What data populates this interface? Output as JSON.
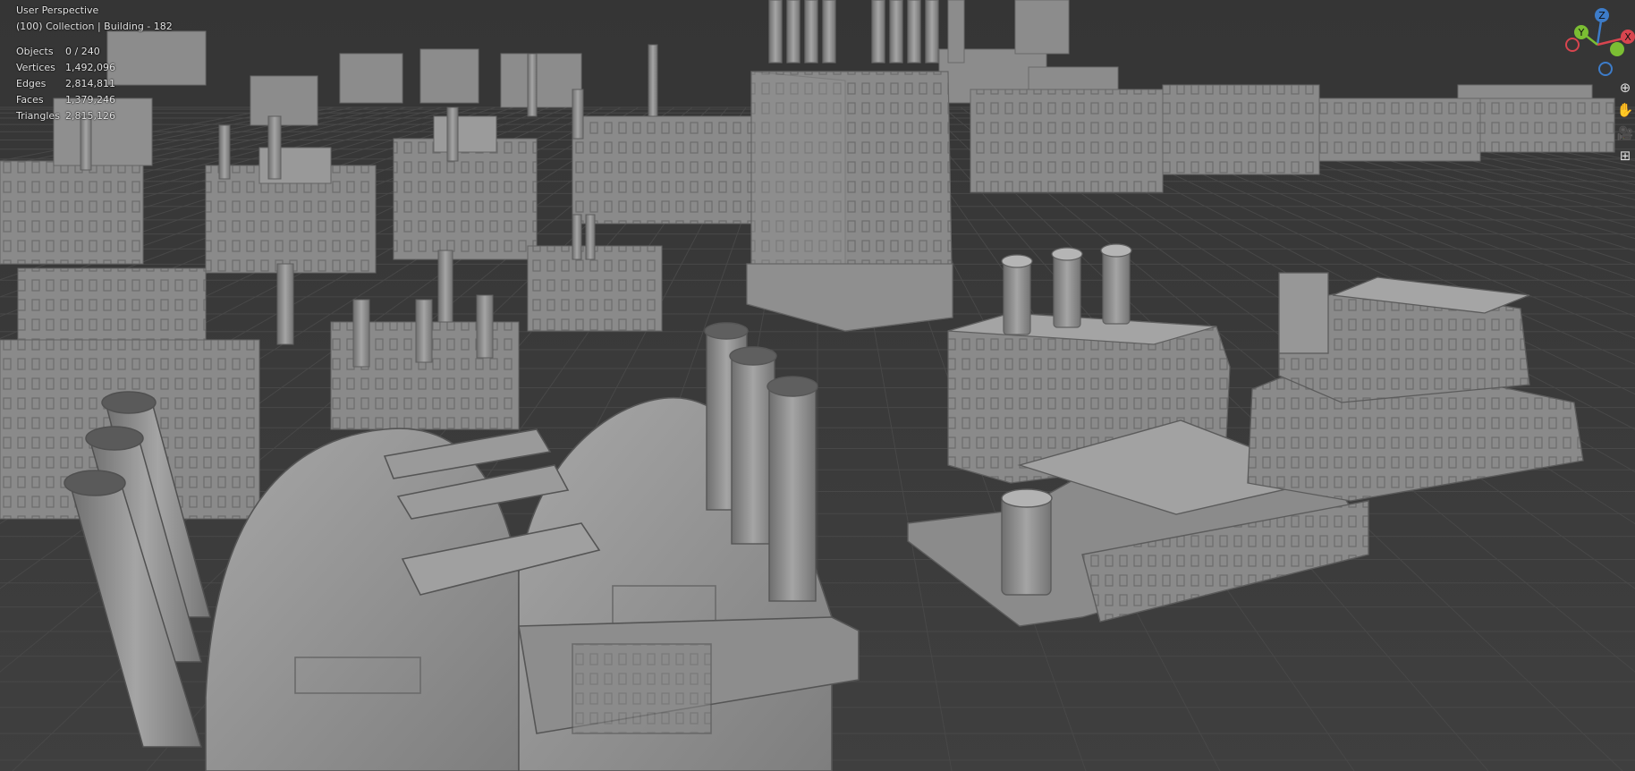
{
  "viewport": {
    "title": "User Perspective",
    "collection_line": "(100) Collection | Building - 182"
  },
  "stats": [
    {
      "label": "Objects",
      "value": "0 / 240"
    },
    {
      "label": "Vertices",
      "value": "1,492,096"
    },
    {
      "label": "Edges",
      "value": "2,814,811"
    },
    {
      "label": "Faces",
      "value": "1,379,246"
    },
    {
      "label": "Triangles",
      "value": "2,815,126"
    }
  ],
  "gizmo": {
    "z_label": "Z",
    "y_label": "Y",
    "x_label": "X",
    "colors": {
      "x": "#d8454f",
      "y": "#7bbe33",
      "z": "#3d7cc9"
    }
  },
  "nav_icons": [
    "zoom-icon",
    "hand-pan-icon",
    "camera-icon",
    "ortho-grid-icon"
  ],
  "colors": {
    "background": "#3d3d3d",
    "grid_line": "#454545",
    "model_gray": "#8f8f8f",
    "text": "#e6e6e6"
  }
}
